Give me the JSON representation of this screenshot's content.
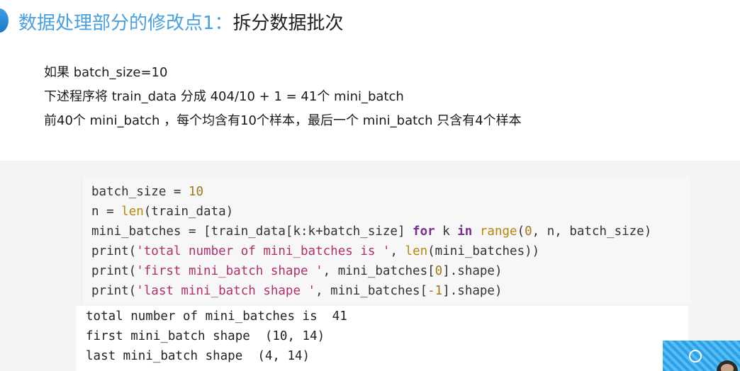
{
  "title": {
    "prefix": "数据处理部分的修改点1：",
    "suffix": "拆分数据批次"
  },
  "description": [
    "如果 batch_size=10",
    "下述程序将 train_data 分成 404/10 + 1 = 41个 mini_batch",
    "前40个 mini_batch ，每个均含有10个样本，最后一个 mini_batch 只含有4个样本"
  ],
  "code_lines": [
    [
      {
        "t": "batch_size = ",
        "k": "plain"
      },
      {
        "t": "10",
        "k": "number"
      }
    ],
    [
      {
        "t": "n = ",
        "k": "plain"
      },
      {
        "t": "len",
        "k": "builtin"
      },
      {
        "t": "(train_data)",
        "k": "plain"
      }
    ],
    [
      {
        "t": "mini_batches = [train_data[k:k+batch_size] ",
        "k": "plain"
      },
      {
        "t": "for",
        "k": "keyword"
      },
      {
        "t": " k ",
        "k": "plain"
      },
      {
        "t": "in",
        "k": "keyword"
      },
      {
        "t": " ",
        "k": "plain"
      },
      {
        "t": "range",
        "k": "builtin"
      },
      {
        "t": "(",
        "k": "plain"
      },
      {
        "t": "0",
        "k": "number"
      },
      {
        "t": ", n, batch_size)",
        "k": "plain"
      }
    ],
    [
      {
        "t": "print(",
        "k": "plain"
      },
      {
        "t": "'total number of mini_batches is '",
        "k": "string"
      },
      {
        "t": ", ",
        "k": "plain"
      },
      {
        "t": "len",
        "k": "builtin"
      },
      {
        "t": "(mini_batches))",
        "k": "plain"
      }
    ],
    [
      {
        "t": "print(",
        "k": "plain"
      },
      {
        "t": "'first mini_batch shape '",
        "k": "string"
      },
      {
        "t": ", mini_batches[",
        "k": "plain"
      },
      {
        "t": "0",
        "k": "number"
      },
      {
        "t": "].shape)",
        "k": "plain"
      }
    ],
    [
      {
        "t": "print(",
        "k": "plain"
      },
      {
        "t": "'last mini_batch shape '",
        "k": "string"
      },
      {
        "t": ", mini_batches[",
        "k": "plain"
      },
      {
        "t": "-1",
        "k": "number"
      },
      {
        "t": "].shape)",
        "k": "plain"
      }
    ]
  ],
  "output_lines": [
    "total number of mini_batches is  41",
    "first mini_batch shape  (10, 14)",
    "last mini_batch shape  (4, 14)"
  ],
  "colors": {
    "title_accent": "#4a9fe0",
    "string": "#b0306a",
    "keyword": "#7a2d91",
    "builtin": "#b8860b",
    "number": "#a2781a"
  },
  "icons": {
    "slide_marker": "slide-marker-icon",
    "webcam": "webcam-thumbnail"
  }
}
